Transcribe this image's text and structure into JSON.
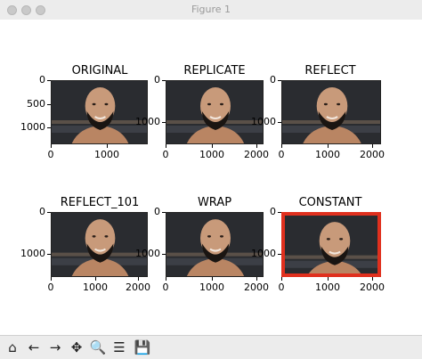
{
  "window": {
    "title": "Figure 1"
  },
  "panels": [
    {
      "title": "ORIGINAL",
      "xticks": [
        "0",
        "1000"
      ],
      "yticks": [
        "0",
        "500",
        "1000"
      ],
      "border": "none"
    },
    {
      "title": "REPLICATE",
      "xticks": [
        "0",
        "1000",
        "2000"
      ],
      "yticks": [
        "0",
        "1000"
      ],
      "border": "none"
    },
    {
      "title": "REFLECT",
      "xticks": [
        "0",
        "1000",
        "2000"
      ],
      "yticks": [
        "0",
        "1000"
      ],
      "border": "none"
    },
    {
      "title": "REFLECT_101",
      "xticks": [
        "0",
        "1000",
        "2000"
      ],
      "yticks": [
        "0",
        "1000"
      ],
      "border": "none"
    },
    {
      "title": "WRAP",
      "xticks": [
        "0",
        "1000",
        "2000"
      ],
      "yticks": [
        "0",
        "1000"
      ],
      "border": "none"
    },
    {
      "title": "CONSTANT",
      "xticks": [
        "0",
        "1000",
        "2000"
      ],
      "yticks": [
        "0",
        "1000"
      ],
      "border": "#e0301e"
    }
  ],
  "toolbar": [
    {
      "name": "home-icon",
      "glyph": "⌂"
    },
    {
      "name": "back-arrow-icon",
      "glyph": "←"
    },
    {
      "name": "forward-arrow-icon",
      "glyph": "→"
    },
    {
      "name": "pan-icon",
      "glyph": "✥"
    },
    {
      "name": "zoom-icon",
      "glyph": "🔍"
    },
    {
      "name": "configure-subplots-icon",
      "glyph": "☰"
    },
    {
      "name": "save-icon",
      "glyph": "💾"
    }
  ],
  "colors": {
    "constant_border": "#e0301e",
    "image_bg": "#2b2b2b",
    "skin": "#c89a7a",
    "beard": "#1a1512"
  }
}
